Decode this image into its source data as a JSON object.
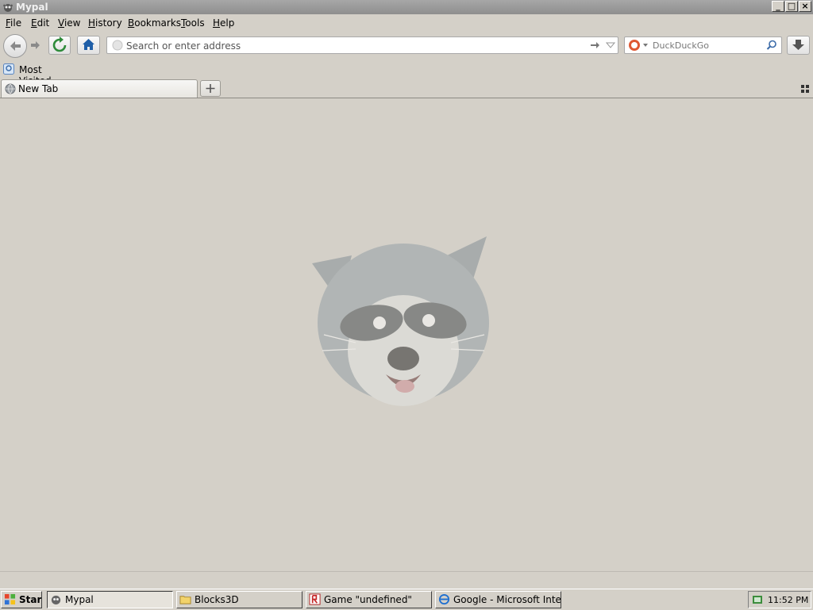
{
  "window": {
    "title": "Mypal"
  },
  "menu": [
    {
      "label": "File",
      "u": "F",
      "rest": "ile"
    },
    {
      "label": "Edit",
      "u": "E",
      "rest": "dit"
    },
    {
      "label": "View",
      "u": "V",
      "rest": "iew"
    },
    {
      "label": "History",
      "u": "H",
      "rest": "istory"
    },
    {
      "label": "Bookmarks",
      "u": "B",
      "rest": "ookmarks"
    },
    {
      "label": "Tools",
      "u": "T",
      "rest": "ools"
    },
    {
      "label": "Help",
      "u": "H",
      "rest": "elp"
    }
  ],
  "urlbar": {
    "placeholder": "Search or enter address"
  },
  "search": {
    "placeholder": "DuckDuckGo"
  },
  "bookmarks": {
    "most_visited": "Most Visited"
  },
  "tabs": [
    {
      "label": "New Tab"
    }
  ],
  "taskbar": {
    "start": "Start",
    "tasks": [
      {
        "label": "Mypal"
      },
      {
        "label": "Blocks3D"
      },
      {
        "label": "Game \"undefined\""
      },
      {
        "label": "Google - Microsoft Intern..."
      }
    ],
    "clock": "11:52 PM"
  },
  "colors": {
    "titlebar": "#9a9a9a",
    "chrome": "#d4d0c8",
    "home_blue": "#1f5fa8",
    "reload_green": "#2e8b3a"
  },
  "icons": [
    "mypal-icon",
    "back-arrow-icon",
    "forward-arrow-icon",
    "reload-icon",
    "home-icon",
    "go-arrow-icon",
    "dropdown-arrow-icon",
    "duckduckgo-icon",
    "search-magnifier-icon",
    "download-icon",
    "most-visited-icon",
    "globe-icon",
    "new-tab-plus-icon",
    "tab-grid-icon",
    "raccoon-logo-icon",
    "windows-flag-icon",
    "folder-icon",
    "game-icon",
    "ie-icon",
    "tray-icon"
  ]
}
